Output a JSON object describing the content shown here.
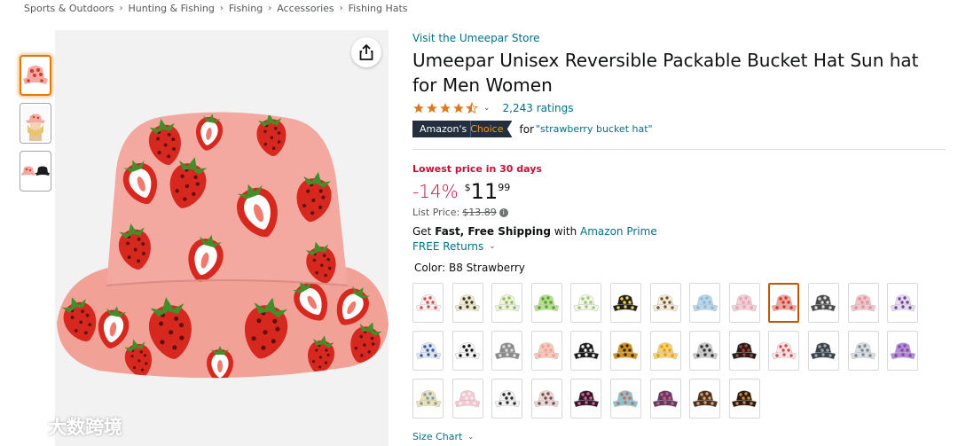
{
  "breadcrumb": [
    "Sports & Outdoors",
    "Hunting & Fishing",
    "Fishing",
    "Accessories",
    "Fishing Hats"
  ],
  "breadcrumb_separator": "›",
  "store_link": "Visit the Umeepar Store",
  "title": "Umeepar Unisex Reversible Packable Bucket Hat Sun hat for Men Women",
  "rating": {
    "stars": 4.5,
    "count_label": "2,243 ratings"
  },
  "choice": {
    "badge_left": "Amazon's",
    "badge_right": "Choice",
    "for_label": "for",
    "keyword": "\"strawberry bucket hat\""
  },
  "deal_label": "Lowest price in 30 days",
  "price": {
    "discount": "-14%",
    "symbol": "$",
    "whole": "11",
    "fraction": "99"
  },
  "list_price": {
    "label": "List Price:",
    "value": "$13.89"
  },
  "shipping": {
    "prefix": "Get ",
    "bold": "Fast, Free Shipping",
    "middle": " with ",
    "link": "Amazon Prime"
  },
  "returns_label": "FREE Returns",
  "color": {
    "label": "Color:",
    "value": "B8 Strawberry"
  },
  "size_chart_label": "Size Chart",
  "watermark_text": "大数跨境",
  "selected_swatch_index": 9,
  "swatches": [
    {
      "base": "#f3f3f3",
      "accent": "#d94b4b"
    },
    {
      "base": "#f4e9c7",
      "accent": "#3a3a3a"
    },
    {
      "base": "#f1f1e3",
      "accent": "#8cc152"
    },
    {
      "base": "#b7e08a",
      "accent": "#5c9e3a"
    },
    {
      "base": "#f3f3f0",
      "accent": "#9ccc65"
    },
    {
      "base": "#1f1f1f",
      "accent": "#f5d442"
    },
    {
      "base": "#f6ecd6",
      "accent": "#6b5a3a"
    },
    {
      "base": "#b9d7ea",
      "accent": "#8fb8d4"
    },
    {
      "base": "#f4cfd6",
      "accent": "#e8a0ae"
    },
    {
      "base": "#f2a49c",
      "accent": "#c83a2e"
    },
    {
      "base": "#4a4a4a",
      "accent": "#dddddd"
    },
    {
      "base": "#f2c4cc",
      "accent": "#e58ea0"
    },
    {
      "base": "#e7d9f2",
      "accent": "#6a4c93"
    },
    {
      "base": "#dfe9f5",
      "accent": "#3b5b9a"
    },
    {
      "base": "#f5f5f5",
      "accent": "#111111"
    },
    {
      "base": "#8a8a8a",
      "accent": "#dcdcdc"
    },
    {
      "base": "#f9c8bd",
      "accent": "#f2a08e"
    },
    {
      "base": "#1c1c1c",
      "accent": "#f4f4f4"
    },
    {
      "base": "#d4931c",
      "accent": "#3a2a12"
    },
    {
      "base": "#f5d36a",
      "accent": "#e39b1b"
    },
    {
      "base": "#c9c9c9",
      "accent": "#333333"
    },
    {
      "base": "#1e1e1e",
      "accent": "#c0392b"
    },
    {
      "base": "#f7e6e6",
      "accent": "#d94848"
    },
    {
      "base": "#3a4148",
      "accent": "#9aa5ae"
    },
    {
      "base": "#d9dde2",
      "accent": "#7c8793"
    },
    {
      "base": "#b58ad6",
      "accent": "#7d4ea8"
    },
    {
      "base": "#f2e3a0",
      "accent": "#6f9be0"
    },
    {
      "base": "#f6c5cf",
      "accent": "#f3f3f3"
    },
    {
      "base": "#f1f1f1",
      "accent": "#2b2b2b"
    },
    {
      "base": "#e9d7d7",
      "accent": "#7c4a4a"
    },
    {
      "base": "#2d1a2b",
      "accent": "#e05a8a"
    },
    {
      "base": "#7fc6d9",
      "accent": "#e9603f"
    },
    {
      "base": "#5a3b6a",
      "accent": "#e0556e"
    },
    {
      "base": "#4a2e22",
      "accent": "#d9a066"
    },
    {
      "base": "#2a1a12",
      "accent": "#c98a3a"
    }
  ],
  "thumbnails": [
    {
      "kind": "hat",
      "base": "#f3a9a0",
      "accent": "#d23a2e"
    },
    {
      "kind": "person",
      "base": "#f3d8b4",
      "accent": "#e8c56b"
    },
    {
      "kind": "pair",
      "base": "#f3a9a0",
      "accent": "#1c1c1c"
    }
  ],
  "colors": {
    "link": "#007185",
    "deal": "#cc0c39",
    "star": "#de7921",
    "hat_pink": "#f3a9a0",
    "strawberry": "#d7281f",
    "leaf": "#3f8f2a"
  }
}
